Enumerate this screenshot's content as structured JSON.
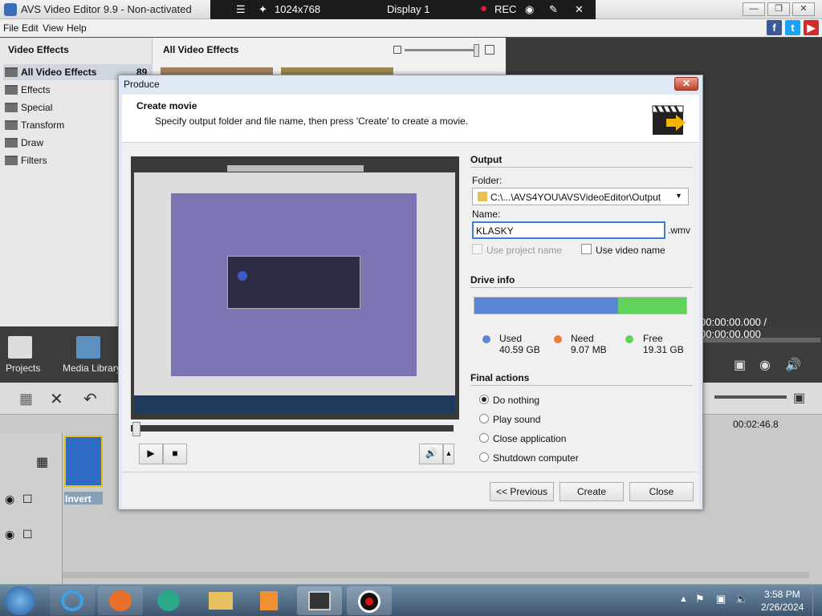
{
  "window": {
    "title": "AVS Video Editor 9.9 - Non-activated"
  },
  "bandicam": {
    "resolution": "1024x768",
    "display": "Display 1",
    "rec": "REC"
  },
  "menu": [
    "File",
    "Edit",
    "View",
    "Help"
  ],
  "left_panel": {
    "title": "Video Effects",
    "categories": [
      {
        "label": "All Video Effects",
        "count": "89"
      },
      {
        "label": "Effects"
      },
      {
        "label": "Special"
      },
      {
        "label": "Transform"
      },
      {
        "label": "Draw"
      },
      {
        "label": "Filters"
      }
    ]
  },
  "effects_area": {
    "title": "All Video Effects"
  },
  "bottom": {
    "projects": "Projects",
    "media_library": "Media Library",
    "time": "00:00:00.000  /  00:00:00.000"
  },
  "timeline": {
    "time_mark": "00:02:46.8",
    "clip_label": "Invert"
  },
  "dialog": {
    "title": "Produce",
    "close": "x",
    "header_title": "Create movie",
    "header_desc": "Specify output folder and file name, then press 'Create' to create a movie.",
    "output": {
      "section": "Output",
      "folder_label": "Folder:",
      "folder_value": "C:\\...\\AVS4YOU\\AVSVideoEditor\\Output",
      "name_label": "Name:",
      "name_value": "KLASKY",
      "ext": ".wmv",
      "use_project_name": "Use project name",
      "use_video_name": "Use video name"
    },
    "drive": {
      "section": "Drive info",
      "used_fraction": 0.677,
      "used_label": "Used",
      "used_value": "40.59 GB",
      "need_label": "Need",
      "need_value": "9.07 MB",
      "free_label": "Free",
      "free_value": "19.31 GB",
      "colors": {
        "used": "#5b86d6",
        "need": "#ea7d3c",
        "free": "#5fd35a"
      }
    },
    "final": {
      "section": "Final actions",
      "options": [
        "Do nothing",
        "Play sound",
        "Close application",
        "Shutdown computer"
      ],
      "selected": 0
    },
    "buttons": {
      "previous": "<< Previous",
      "create": "Create",
      "close": "Close"
    }
  },
  "taskbar": {
    "time": "3:58 PM",
    "date": "2/26/2024"
  }
}
